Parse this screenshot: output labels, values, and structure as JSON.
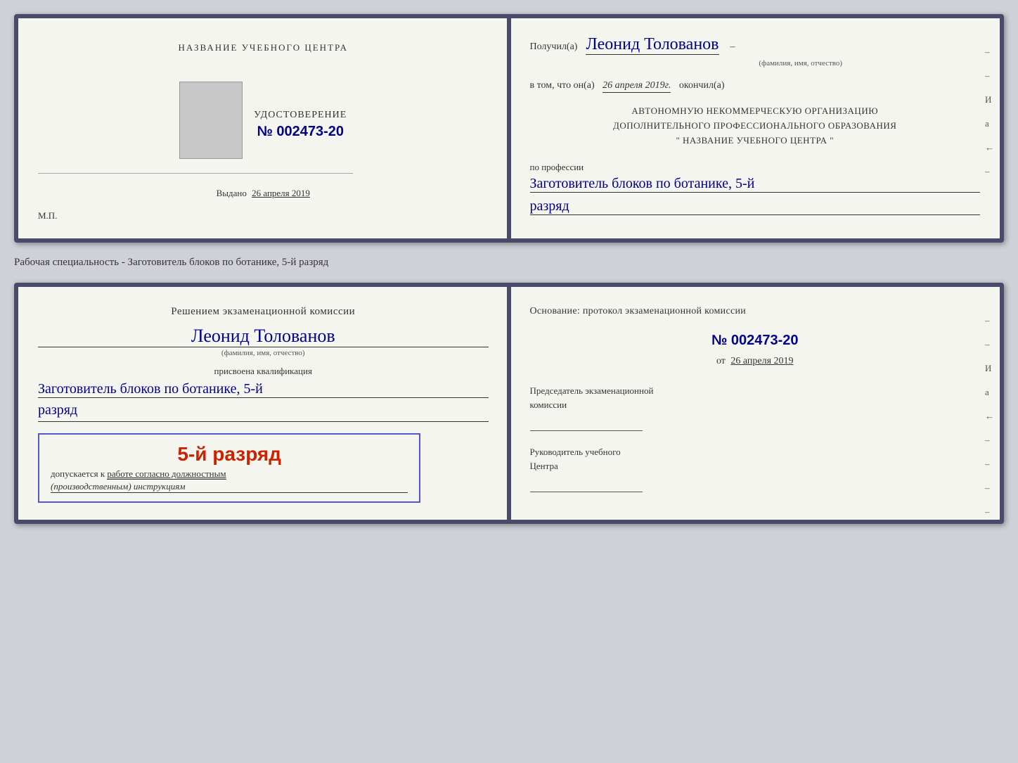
{
  "top_doc": {
    "left": {
      "training_center_label": "НАЗВАНИЕ УЧЕБНОГО ЦЕНТРА",
      "certificate_title": "УДОСТОВЕРЕНИЕ",
      "certificate_number_prefix": "№",
      "certificate_number": "002473-20",
      "issued_label": "Выдано",
      "issued_date": "26 апреля 2019",
      "mp_label": "М.П."
    },
    "right": {
      "recipient_prefix": "Получил(а)",
      "recipient_name": "Леонид Толованов",
      "fio_label": "(фамилия, имя, отчество)",
      "date_prefix": "в том, что он(а)",
      "date_value": "26 апреля 2019г.",
      "date_suffix": "окончил(а)",
      "org_line1": "АВТОНОМНУЮ НЕКОММЕРЧЕСКУЮ ОРГАНИЗАЦИЮ",
      "org_line2": "ДОПОЛНИТЕЛЬНОГО ПРОФЕССИОНАЛЬНОГО ОБРАЗОВАНИЯ",
      "org_line3": "\"  НАЗВАНИЕ УЧЕБНОГО ЦЕНТРА  \"",
      "profession_label": "по профессии",
      "profession_value": "Заготовитель блоков по ботанике, 5-й",
      "rank_value": "разряд"
    }
  },
  "middle_label": "Рабочая специальность - Заготовитель блоков по ботанике, 5-й разряд",
  "bottom_doc": {
    "left": {
      "commission_heading_line1": "Решением экзаменационной комиссии",
      "person_name": "Леонид Толованов",
      "fio_label": "(фамилия, имя, отчество)",
      "qualification_label": "присвоена квалификация",
      "profession_value": "Заготовитель блоков по ботанике, 5-й",
      "rank_value": "разряд",
      "stamp_rank": "5-й разряд",
      "stamp_allowed_prefix": "допускается к",
      "stamp_allowed_text": "работе согласно должностным",
      "stamp_allowed_italic": "(производственным) инструкциям"
    },
    "right": {
      "basis_heading": "Основание: протокол экзаменационной комиссии",
      "protocol_number_prefix": "№",
      "protocol_number": "002473-20",
      "protocol_date_prefix": "от",
      "protocol_date": "26 апреля 2019",
      "chairman_label_line1": "Председатель экзаменационной",
      "chairman_label_line2": "комиссии",
      "director_label_line1": "Руководитель учебного",
      "director_label_line2": "Центра"
    }
  },
  "side_marks": {
    "marks": [
      "–",
      "–",
      "И",
      "а",
      "←",
      "–",
      "–",
      "–",
      "–"
    ]
  }
}
